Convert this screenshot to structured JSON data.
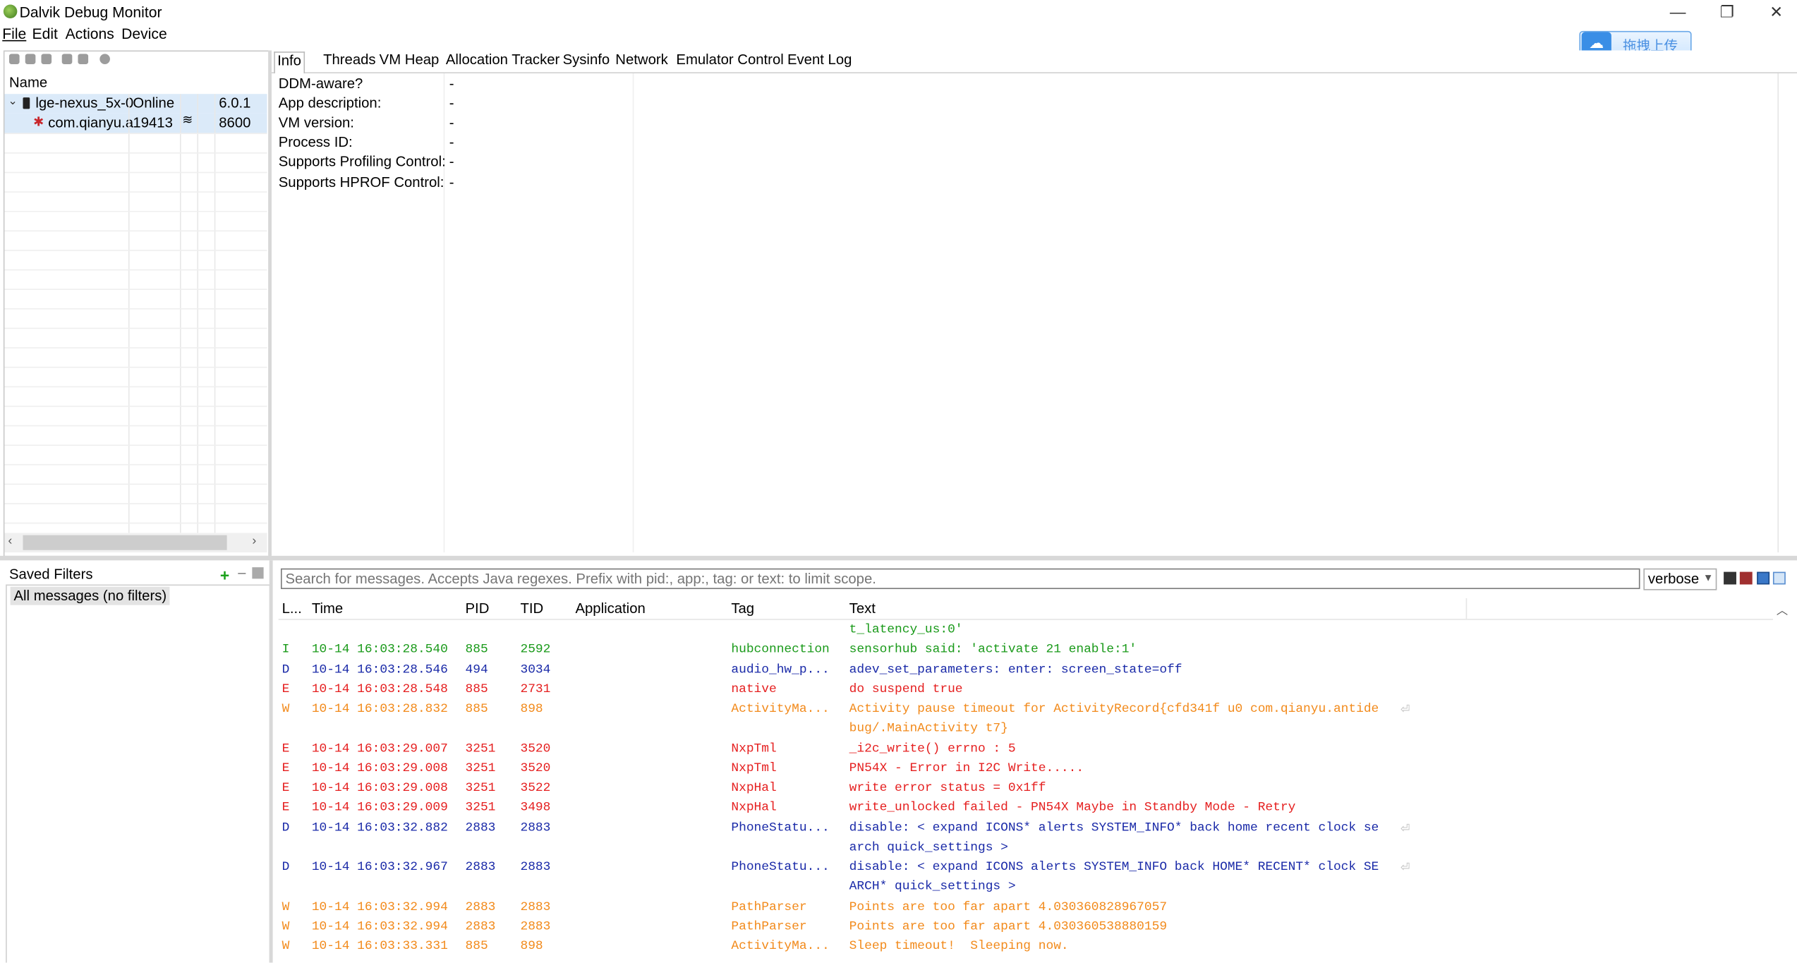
{
  "window": {
    "title": "Dalvik Debug Monitor",
    "min_glyph": "—",
    "restore_glyph": "❐",
    "close_glyph": "✕"
  },
  "menu": {
    "file": "File",
    "edit": "Edit",
    "actions": "Actions",
    "device": "Device"
  },
  "overlay": {
    "upload_label": "拖拽上传",
    "upload_icon": "cloud-icon"
  },
  "devices": {
    "header_name": "Name",
    "rows": [
      {
        "name": "lge-nexus_5x-0",
        "status": "Online",
        "extra": "",
        "version": "6.0.1"
      },
      {
        "name": "com.qianyu.a",
        "status": "19413",
        "extra": "≋",
        "version": "8600"
      }
    ]
  },
  "tabs": [
    {
      "label": "Info",
      "active": true
    },
    {
      "label": "Threads"
    },
    {
      "label": "VM Heap"
    },
    {
      "label": "Allocation Tracker"
    },
    {
      "label": "Sysinfo"
    },
    {
      "label": "Network"
    },
    {
      "label": "Emulator Control"
    },
    {
      "label": "Event Log"
    }
  ],
  "info": [
    {
      "key": "DDM-aware?",
      "value": "-"
    },
    {
      "key": "App description:",
      "value": "-"
    },
    {
      "key": "VM version:",
      "value": "-"
    },
    {
      "key": "Process ID:",
      "value": "-"
    },
    {
      "key": "Supports Profiling Control:",
      "value": "-"
    },
    {
      "key": "Supports HPROF Control:",
      "value": "-"
    }
  ],
  "filters": {
    "title": "Saved Filters",
    "add_glyph": "+",
    "remove_glyph": "−",
    "items": [
      "All messages (no filters)"
    ]
  },
  "logcat": {
    "search_placeholder": "Search for messages. Accepts Java regexes. Prefix with pid:, app:, tag: or text: to limit scope.",
    "level": "verbose",
    "columns": {
      "level": "L...",
      "time": "Time",
      "pid": "PID",
      "tid": "TID",
      "app": "Application",
      "tag": "Tag",
      "text": "Text"
    },
    "rows": [
      {
        "level": "",
        "time": "",
        "pid": "",
        "tid": "",
        "tag": "",
        "text": "t_latency_us:0'",
        "color": "I"
      },
      {
        "level": "I",
        "time": "10-14 16:03:28.540",
        "pid": "885",
        "tid": "2592",
        "tag": "hubconnection",
        "text": "sensorhub said: 'activate 21 enable:1'",
        "color": "I"
      },
      {
        "level": "D",
        "time": "10-14 16:03:28.546",
        "pid": "494",
        "tid": "3034",
        "tag": "audio_hw_p...",
        "text": "adev_set_parameters: enter: screen_state=off",
        "color": "D"
      },
      {
        "level": "E",
        "time": "10-14 16:03:28.548",
        "pid": "885",
        "tid": "2731",
        "tag": "native",
        "text": "do suspend true",
        "color": "E"
      },
      {
        "level": "W",
        "time": "10-14 16:03:28.832",
        "pid": "885",
        "tid": "898",
        "tag": "ActivityMa...",
        "text": "Activity pause timeout for ActivityRecord{cfd341f u0 com.qianyu.antide",
        "color": "W",
        "wrap": true
      },
      {
        "level": "",
        "time": "",
        "pid": "",
        "tid": "",
        "tag": "",
        "text": "bug/.MainActivity t7}",
        "color": "W"
      },
      {
        "level": "E",
        "time": "10-14 16:03:29.007",
        "pid": "3251",
        "tid": "3520",
        "tag": "NxpTml",
        "text": "_i2c_write() errno : 5",
        "color": "E"
      },
      {
        "level": "E",
        "time": "10-14 16:03:29.008",
        "pid": "3251",
        "tid": "3520",
        "tag": "NxpTml",
        "text": "PN54X - Error in I2C Write.....",
        "color": "E"
      },
      {
        "level": "E",
        "time": "10-14 16:03:29.008",
        "pid": "3251",
        "tid": "3522",
        "tag": "NxpHal",
        "text": "write error status = 0x1ff",
        "color": "E"
      },
      {
        "level": "E",
        "time": "10-14 16:03:29.009",
        "pid": "3251",
        "tid": "3498",
        "tag": "NxpHal",
        "text": "write_unlocked failed - PN54X Maybe in Standby Mode - Retry",
        "color": "E"
      },
      {
        "level": "D",
        "time": "10-14 16:03:32.882",
        "pid": "2883",
        "tid": "2883",
        "tag": "PhoneStatu...",
        "text": "disable: < expand ICONS* alerts SYSTEM_INFO* back home recent clock se",
        "color": "D",
        "wrap": true
      },
      {
        "level": "",
        "time": "",
        "pid": "",
        "tid": "",
        "tag": "",
        "text": "arch quick_settings >",
        "color": "D"
      },
      {
        "level": "D",
        "time": "10-14 16:03:32.967",
        "pid": "2883",
        "tid": "2883",
        "tag": "PhoneStatu...",
        "text": "disable: < expand ICONS alerts SYSTEM_INFO back HOME* RECENT* clock SE",
        "color": "D",
        "wrap": true
      },
      {
        "level": "",
        "time": "",
        "pid": "",
        "tid": "",
        "tag": "",
        "text": "ARCH* quick_settings >",
        "color": "D"
      },
      {
        "level": "W",
        "time": "10-14 16:03:32.994",
        "pid": "2883",
        "tid": "2883",
        "tag": "PathParser",
        "text": "Points are too far apart 4.030360828967057",
        "color": "W"
      },
      {
        "level": "W",
        "time": "10-14 16:03:32.994",
        "pid": "2883",
        "tid": "2883",
        "tag": "PathParser",
        "text": "Points are too far apart 4.030360538880159",
        "color": "W"
      },
      {
        "level": "W",
        "time": "10-14 16:03:33.331",
        "pid": "885",
        "tid": "898",
        "tag": "ActivityMa...",
        "text": "Sleep timeout!  Sleeping now.",
        "color": "W"
      }
    ]
  },
  "colors": {
    "info": "#1a9a1a",
    "debug": "#1a2aa8",
    "error": "#e51f1f",
    "warn": "#f28a1b",
    "selection": "#dbeaf9"
  }
}
